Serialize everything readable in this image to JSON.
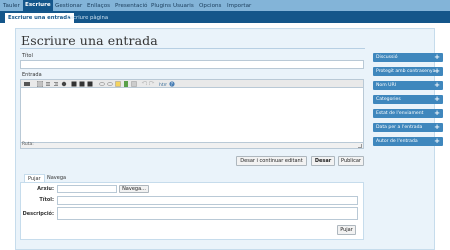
{
  "nav": {
    "items": [
      {
        "label": "Tauler"
      },
      {
        "label": "Escriure"
      },
      {
        "label": "Gestionar"
      },
      {
        "label": "Enllaços"
      },
      {
        "label": "Presentació"
      },
      {
        "label": "Plugins"
      },
      {
        "label": "Usuaris"
      },
      {
        "label": "Opcions"
      },
      {
        "label": "Importar"
      }
    ],
    "active_index": 1
  },
  "subnav": {
    "items": [
      {
        "label": "Escriure una entrada"
      },
      {
        "label": "Escriure pàgina"
      }
    ],
    "active_index": 0
  },
  "page": {
    "title": "Escriure una entrada",
    "title_label": "Títol",
    "title_value": "",
    "entry_label": "Entrada",
    "entry_value": "",
    "path_label": "Ruta:"
  },
  "toolbar": {
    "buttons": [
      "bold-icon",
      "italic-icon",
      "strikethrough-icon",
      "bullet-list-icon",
      "numbered-list-icon",
      "blockquote-icon",
      "align-left-icon",
      "align-center-icon",
      "align-right-icon",
      "link-icon",
      "unlink-icon",
      "more-tag-icon",
      "spellcheck-icon",
      "undo-icon",
      "redo-icon",
      "code-icon",
      "help-icon"
    ]
  },
  "actions": {
    "save_continue": "Desar i continuar editant",
    "save": "Desar",
    "publish": "Publicar"
  },
  "upload": {
    "tabs": [
      {
        "label": "Pujar"
      },
      {
        "label": "Navega totes"
      }
    ],
    "active_tab": 0,
    "file_label": "Arxiu:",
    "browse_button": "Navega...",
    "title_label": "Títol:",
    "title_value": "",
    "description_label": "Descripció:",
    "description_value": "",
    "upload_button": "Pujar"
  },
  "sidebar": {
    "panels": [
      {
        "label": "Discussió"
      },
      {
        "label": "Protegit amb contrasenya"
      },
      {
        "label": "Nom URI"
      },
      {
        "label": "Categories"
      },
      {
        "label": "Estat de l'enviament"
      },
      {
        "label": "Data per a l'entrada"
      },
      {
        "label": "Autor de l'entrada"
      }
    ],
    "expand_symbol": "+"
  },
  "colors": {
    "top_nav": "#83b4d8",
    "sub_nav": "#14568a",
    "sidebar_panel": "#3f87bd",
    "page_bg": "#eaf3fa"
  }
}
